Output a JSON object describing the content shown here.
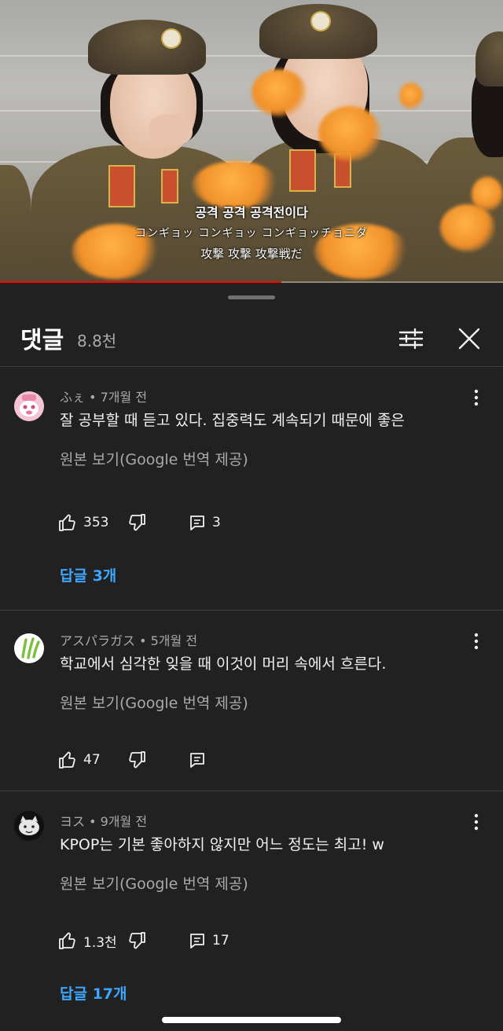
{
  "video": {
    "subtitle_korean": "공격 공격 공격전이다",
    "subtitle_katakana": "コンギョッ コンギョッ コンギョッチョニダ",
    "subtitle_kanji": "攻撃 攻撃 攻撃戦だ",
    "progress_fraction": 0.56,
    "progress_color": "#ff0000"
  },
  "header": {
    "title": "댓글",
    "count": "8.8천",
    "filter_icon": "filter-sliders-icon",
    "close_icon": "close-icon"
  },
  "comments": [
    {
      "author": "ふぇ",
      "time": "7개월 전",
      "text": "잘 공부할 때 듣고 있다. 집중력도 계속되기 때문에 좋은",
      "translate": "원본 보기(Google 번역 제공)",
      "likes": "353",
      "reply_count": "3",
      "replies_link": "답글 3개",
      "avatar_color": "#f4c3d6"
    },
    {
      "author": "アスパラガス",
      "time": "5개월 전",
      "text": "학교에서 심각한 잊을 때 이것이 머리 속에서 흐른다.",
      "translate": "원본 보기(Google 번역 제공)",
      "likes": "47",
      "reply_count": "",
      "replies_link": "",
      "avatar_color": "#ffffff"
    },
    {
      "author": "ヨス",
      "time": "9개월 전",
      "text": "KPOP는 기본 좋아하지 않지만 어느 정도는 최고! w",
      "translate": "원본 보기(Google 번역 제공)",
      "likes": "1.3천",
      "reply_count": "17",
      "replies_link": "답글 17개",
      "avatar_color": "#111111"
    }
  ],
  "colors": {
    "background": "#212121",
    "link": "#3ea6ff",
    "muted": "#aaaaaa"
  }
}
